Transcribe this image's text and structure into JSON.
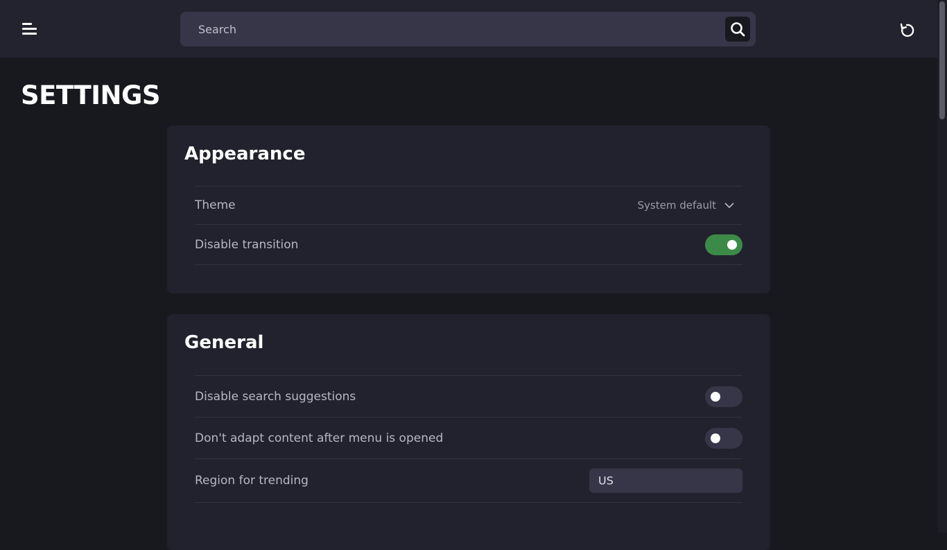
{
  "header": {
    "search_placeholder": "Search",
    "icons": {
      "menu": "menu-icon",
      "search": "search-icon",
      "reset": "reset-icon"
    }
  },
  "page": {
    "title": "SETTINGS"
  },
  "sections": {
    "appearance": {
      "title": "Appearance",
      "theme_label": "Theme",
      "theme_value": "System default",
      "disable_transition_label": "Disable transition",
      "disable_transition_on": true
    },
    "general": {
      "title": "General",
      "disable_search_suggestions_label": "Disable search suggestions",
      "disable_search_suggestions_on": false,
      "dont_adapt_label": "Don't adapt content after menu is opened",
      "dont_adapt_on": false,
      "region_label": "Region for trending",
      "region_value": "US"
    }
  },
  "colors": {
    "background": "#18191f",
    "topbar": "#23232f",
    "card": "#22222e",
    "input": "#363648",
    "toggle_on": "#3c8a47"
  }
}
